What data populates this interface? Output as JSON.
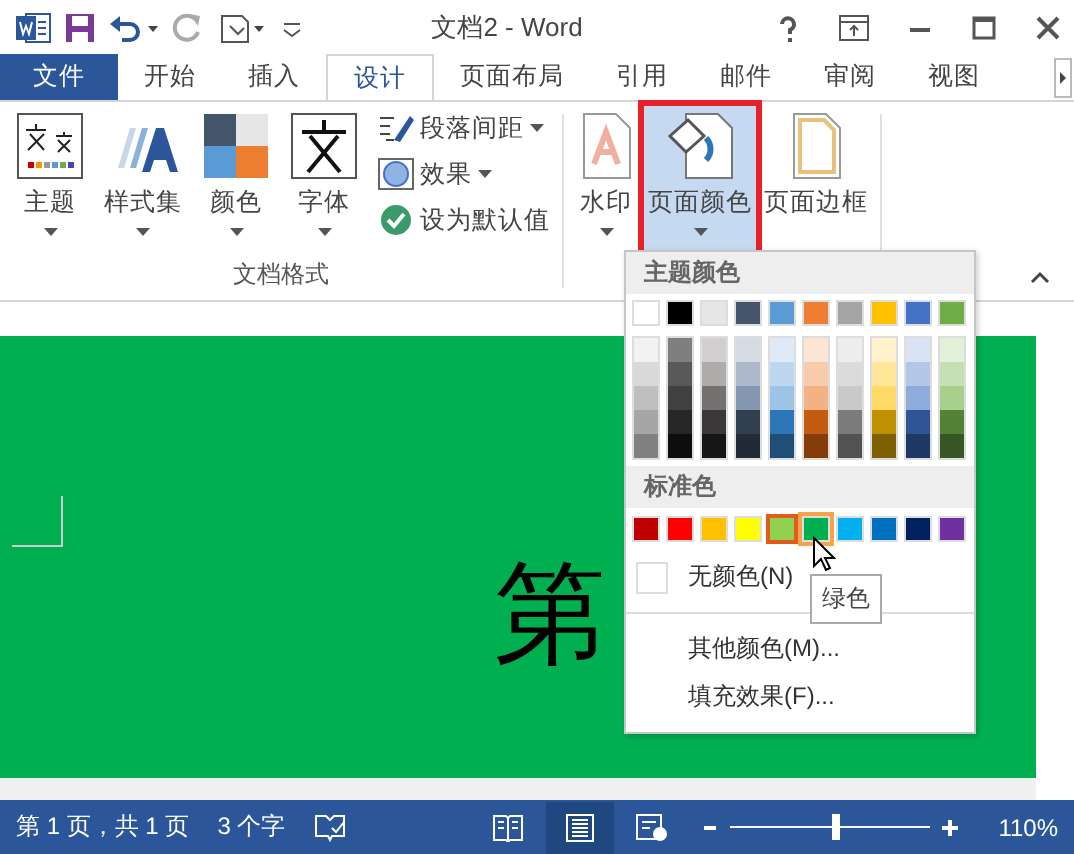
{
  "title_bar": {
    "title": "文档2 - Word"
  },
  "tabs": [
    {
      "label": "文件",
      "kind": "file",
      "selected": false
    },
    {
      "label": "开始",
      "kind": "tab",
      "selected": false
    },
    {
      "label": "插入",
      "kind": "tab",
      "selected": false
    },
    {
      "label": "设计",
      "kind": "tab",
      "selected": true
    },
    {
      "label": "页面布局",
      "kind": "tab",
      "selected": false
    },
    {
      "label": "引用",
      "kind": "tab",
      "selected": false
    },
    {
      "label": "邮件",
      "kind": "tab",
      "selected": false
    },
    {
      "label": "审阅",
      "kind": "tab",
      "selected": false
    },
    {
      "label": "视图",
      "kind": "tab",
      "selected": false
    }
  ],
  "ribbon": {
    "group_label": "文档格式",
    "format_buttons": [
      {
        "label": "主题",
        "kind": "theme"
      },
      {
        "label": "样式集",
        "kind": "styles"
      },
      {
        "label": "颜色",
        "kind": "colors"
      },
      {
        "label": "字体",
        "kind": "fonts"
      }
    ],
    "small_buttons": [
      {
        "label": "段落间距",
        "kind": "spacing",
        "dropdown": true
      },
      {
        "label": "效果",
        "kind": "effects",
        "dropdown": true
      },
      {
        "label": "设为默认值",
        "kind": "default",
        "dropdown": false
      }
    ],
    "page_buttons": [
      {
        "label": "水印",
        "kind": "watermark",
        "dropdown": true,
        "selected": false
      },
      {
        "label": "页面颜色",
        "kind": "page_color",
        "dropdown": true,
        "selected": true
      },
      {
        "label": "页面边框",
        "kind": "page_border",
        "dropdown": false,
        "selected": false
      }
    ]
  },
  "page_color_menu": {
    "theme_header": "主题颜色",
    "theme_colors": [
      {
        "color": "#ffffff",
        "shades": [
          {
            "color": "#f2f2f2"
          },
          {
            "color": "#d9d9d9"
          },
          {
            "color": "#bfbfbf"
          },
          {
            "color": "#a6a6a6"
          },
          {
            "color": "#808080"
          }
        ]
      },
      {
        "color": "#000000",
        "shades": [
          {
            "color": "#7f7f7f"
          },
          {
            "color": "#595959"
          },
          {
            "color": "#404040"
          },
          {
            "color": "#262626"
          },
          {
            "color": "#0d0d0d"
          }
        ]
      },
      {
        "color": "#e7e6e6",
        "shades": [
          {
            "color": "#d0cece"
          },
          {
            "color": "#aeabab"
          },
          {
            "color": "#757171"
          },
          {
            "color": "#3a3838"
          },
          {
            "color": "#171616"
          }
        ]
      },
      {
        "color": "#44546a",
        "shades": [
          {
            "color": "#d6dce4"
          },
          {
            "color": "#adb9ca"
          },
          {
            "color": "#8496b0"
          },
          {
            "color": "#323f4f"
          },
          {
            "color": "#222a35"
          }
        ]
      },
      {
        "color": "#5b9bd5",
        "shades": [
          {
            "color": "#deebf6"
          },
          {
            "color": "#bdd7ee"
          },
          {
            "color": "#9dc3e6"
          },
          {
            "color": "#2e75b5"
          },
          {
            "color": "#1f4e79"
          }
        ]
      },
      {
        "color": "#ed7d31",
        "shades": [
          {
            "color": "#fbe5d5"
          },
          {
            "color": "#f7cbac"
          },
          {
            "color": "#f4b183"
          },
          {
            "color": "#c55a11"
          },
          {
            "color": "#843c0b"
          }
        ]
      },
      {
        "color": "#a5a5a5",
        "shades": [
          {
            "color": "#ededed"
          },
          {
            "color": "#dbdbdb"
          },
          {
            "color": "#c9c9c9"
          },
          {
            "color": "#7b7b7b"
          },
          {
            "color": "#525252"
          }
        ]
      },
      {
        "color": "#ffc000",
        "shades": [
          {
            "color": "#fff2cc"
          },
          {
            "color": "#ffe699"
          },
          {
            "color": "#ffd966"
          },
          {
            "color": "#bf9000"
          },
          {
            "color": "#7f6000"
          }
        ]
      },
      {
        "color": "#4472c4",
        "shades": [
          {
            "color": "#dae3f3"
          },
          {
            "color": "#b4c7e7"
          },
          {
            "color": "#8faadc"
          },
          {
            "color": "#2f5597"
          },
          {
            "color": "#1f3864"
          }
        ]
      },
      {
        "color": "#70ad47",
        "shades": [
          {
            "color": "#e2efd9"
          },
          {
            "color": "#c5e0b3"
          },
          {
            "color": "#a8d08d"
          },
          {
            "color": "#538135"
          },
          {
            "color": "#375623"
          }
        ]
      }
    ],
    "standard_header": "标准色",
    "standard_colors": [
      {
        "color": "#c00000",
        "selected": false,
        "hovered": false
      },
      {
        "color": "#ff0000",
        "selected": false,
        "hovered": false
      },
      {
        "color": "#ffc000",
        "selected": false,
        "hovered": false
      },
      {
        "color": "#ffff00",
        "selected": false,
        "hovered": false
      },
      {
        "color": "#92d050",
        "selected": true,
        "hovered": false
      },
      {
        "color": "#00b050",
        "selected": false,
        "hovered": true
      },
      {
        "color": "#00b0f0",
        "selected": false,
        "hovered": false
      },
      {
        "color": "#0070c0",
        "selected": false,
        "hovered": false
      },
      {
        "color": "#002060",
        "selected": false,
        "hovered": false
      },
      {
        "color": "#7030a0",
        "selected": false,
        "hovered": false
      }
    ],
    "items": [
      {
        "label": "无颜色(N)",
        "kind": "swatch",
        "separator_before": false
      },
      {
        "label": "其他颜色(M)...",
        "kind": "plain",
        "separator_before": true
      },
      {
        "label": "填充效果(F)...",
        "kind": "plain",
        "separator_before": false
      }
    ],
    "tooltip": "绿色"
  },
  "document": {
    "text": "第"
  },
  "status_bar": {
    "page": "第 1 页，共 1 页",
    "words": "3 个字",
    "views": [
      {
        "kind": "read",
        "selected": false
      },
      {
        "kind": "print",
        "selected": true
      },
      {
        "kind": "web",
        "selected": false
      }
    ],
    "zoom": {
      "level": 0.53,
      "reading": "110%"
    }
  }
}
